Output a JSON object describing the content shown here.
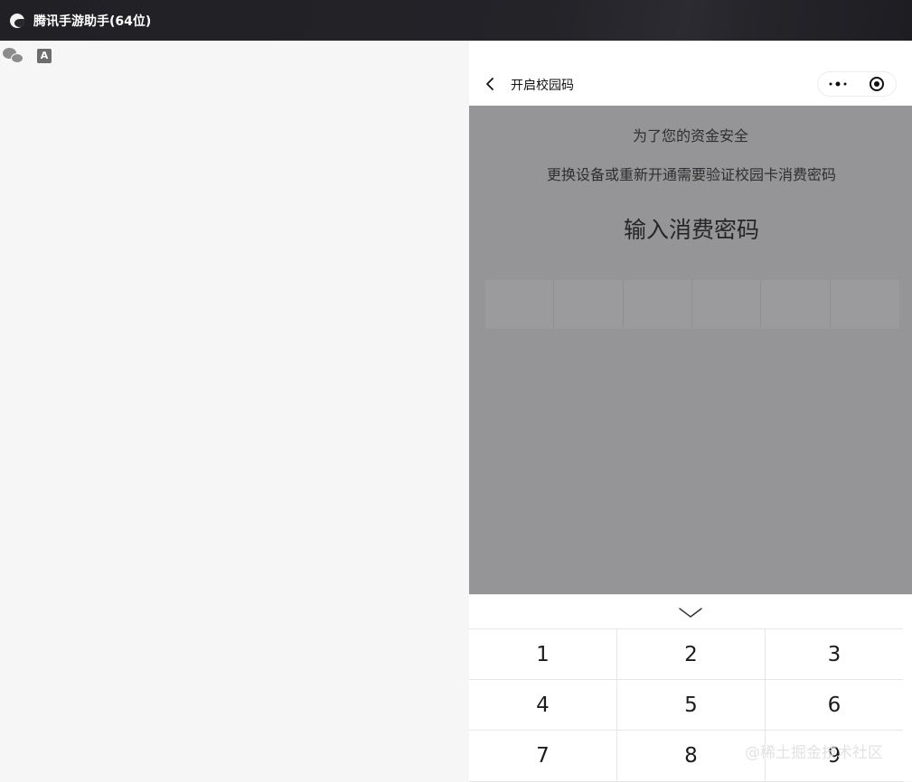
{
  "window": {
    "title": "腾讯手游助手(64位)",
    "logo_icon": "tencent-mobile-game-assistant-logo"
  },
  "left_toolbar": {
    "icons": [
      "wechat-icon",
      "translate-icon"
    ],
    "translate_glyph": "A"
  },
  "nav": {
    "title": "开启校园码",
    "back_icon": "chevron-left-icon",
    "more_icon": "more-dots-icon",
    "close_icon": "close-target-icon"
  },
  "content": {
    "line1": "为了您的资金安全",
    "line2": "更换设备或重新开通需要验证校园卡消费密码",
    "heading": "输入消费密码",
    "pin_length": 6
  },
  "keyboard": {
    "collapse_icon": "chevron-down-icon",
    "keys": [
      "1",
      "2",
      "3",
      "4",
      "5",
      "6",
      "7",
      "8",
      "9"
    ]
  },
  "watermark": "@稀土掘金技术社区",
  "colors": {
    "titlebar": "#232328",
    "overlay": "#959597",
    "page": "#f6f6f6"
  }
}
